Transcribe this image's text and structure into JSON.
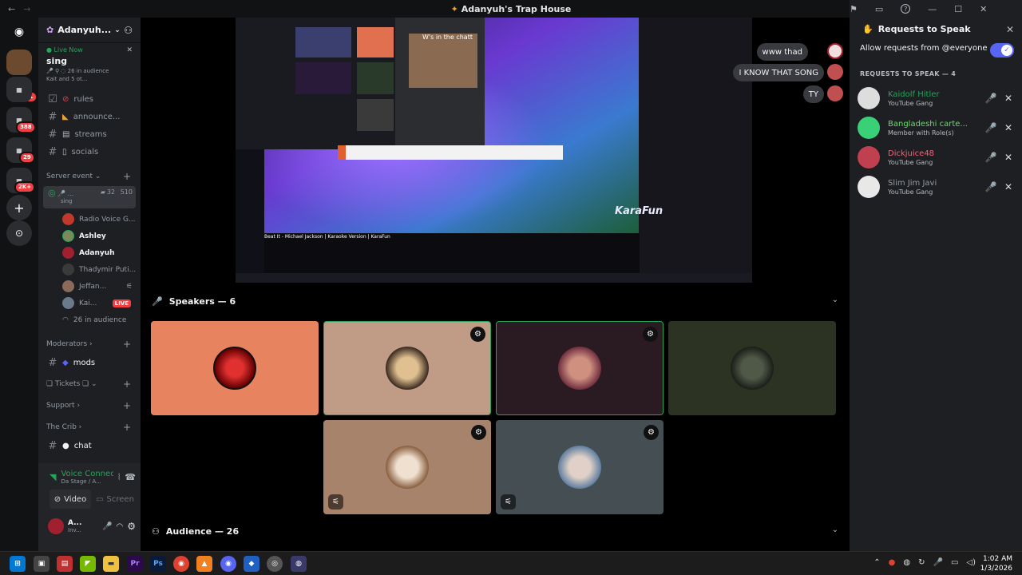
{
  "window": {
    "title": "Adanyuh's Trap House"
  },
  "server": {
    "name": "Adanyuh..."
  },
  "live_event": {
    "label": "Live Now",
    "title": "sing",
    "audience": "26 in audience",
    "members": "Kait and 5 ot..."
  },
  "channels": [
    {
      "name": "rules"
    },
    {
      "name": "announce..."
    },
    {
      "name": "streams"
    },
    {
      "name": "socials"
    }
  ],
  "server_event": {
    "category": "Server event",
    "stage_meta": "32",
    "stage_meta2": "510",
    "stage_sub": "sing",
    "users": [
      "Radio Voice G...",
      "Ashley",
      "Adanyuh",
      "Thadymir Puti...",
      "Jeffan...",
      "Kai..."
    ],
    "live_badge": "LIVE",
    "audience": "26 in audience"
  },
  "categories": {
    "moderators": "Moderators",
    "mods": "mods",
    "tickets": "Tickets",
    "support": "Support",
    "crib": "The Crib",
    "chat": "chat"
  },
  "voice": {
    "status": "Voice Connecte...",
    "channel": "Da Stage / A...",
    "video": "Video",
    "screen": "Screen",
    "user": "A...",
    "user_sub": "Inv..."
  },
  "stream": {
    "chat": [
      "www thad",
      "I KNOW THAT SONG",
      "TY"
    ],
    "overlay_text": "W's in the chatt",
    "video_title": "Beat It - Michael Jackson | Karaoke Version | KaraFun",
    "karafun": "KaraFun"
  },
  "speakers": {
    "label": "Speakers — 6"
  },
  "audience": {
    "label": "Audience — 26"
  },
  "requests": {
    "title": "Requests to Speak",
    "allow_label": "Allow requests from @everyone",
    "section": "REQUESTS TO SPEAK — 4",
    "items": [
      {
        "name": "Kaidolf Hitler",
        "role": "YouTube Gang",
        "color": "#23a55a"
      },
      {
        "name": "Bangladeshi carte...",
        "role": "Member with Role(s)",
        "color": "#5ee35e"
      },
      {
        "name": "Dickjuice48",
        "role": "YouTube Gang",
        "color": "#f0647a"
      },
      {
        "name": "Slim Jim Javi",
        "role": "YouTube Gang",
        "color": "#949ba4"
      }
    ]
  },
  "taskbar": {
    "time": "1:02 AM",
    "date": "1/3/2026"
  },
  "badges": {
    "a": "311",
    "b": "388",
    "c": "29",
    "d": "2K+"
  }
}
